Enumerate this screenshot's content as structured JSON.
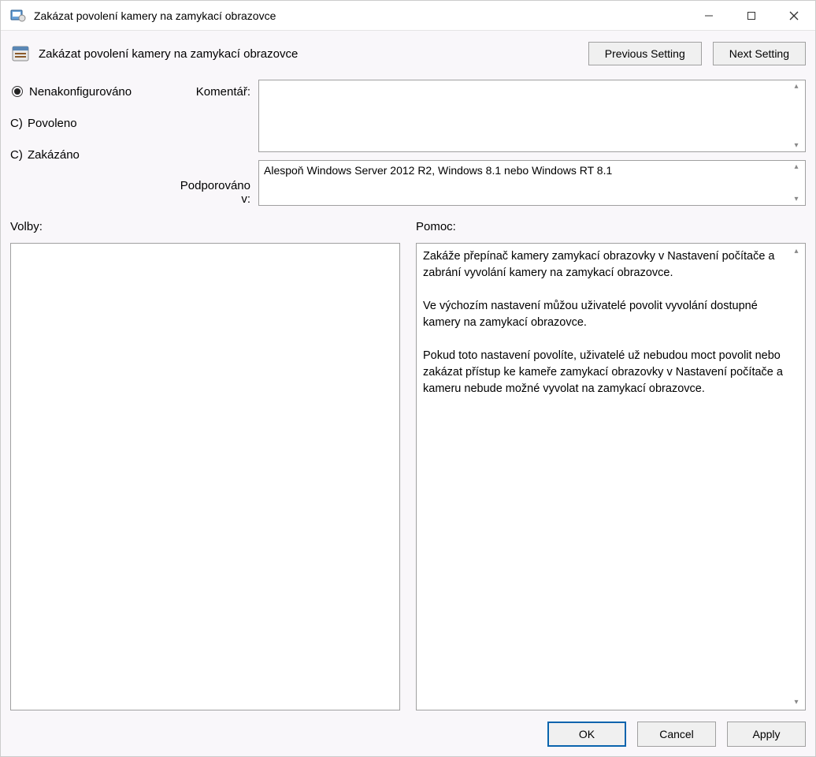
{
  "titlebar": {
    "title": "Zakázat povolení kamery na zamykací obrazovce"
  },
  "header": {
    "title": "Zakázat povolení kamery na zamykací obrazovce",
    "prev": "Previous Setting",
    "next": "Next Setting"
  },
  "radios": {
    "not_configured": "Nenakonfigurováno",
    "enabled_prefix": "C)",
    "enabled": "Povoleno",
    "disabled_prefix": "C)",
    "disabled": "Zakázáno"
  },
  "labels": {
    "comment": "Komentář:",
    "supported": "Podporováno v:",
    "options": "Volby:",
    "help": "Pomoc:"
  },
  "fields": {
    "comment": "",
    "supported": "Alespoň Windows Server 2012 R2, Windows 8.1 nebo Windows RT 8.1"
  },
  "help_text": "Zakáže přepínač kamery zamykací obrazovky v Nastavení počítače a zabrání vyvolání kamery na zamykací obrazovce.\n\nVe výchozím nastavení můžou uživatelé povolit vyvolání dostupné kamery na zamykací obrazovce.\n\nPokud toto nastavení povolíte, uživatelé už nebudou moct povolit nebo zakázat přístup ke kameře zamykací obrazovky v Nastavení počítače a kameru nebude možné vyvolat na zamykací obrazovce.",
  "footer": {
    "ok": "OK",
    "cancel": "Cancel",
    "apply": "Apply"
  }
}
